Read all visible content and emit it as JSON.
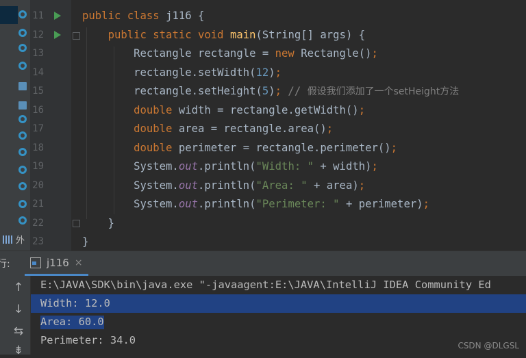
{
  "editor": {
    "lines": [
      {
        "num": "11",
        "tokens": [
          [
            "kw",
            "public "
          ],
          [
            "kw",
            "class "
          ],
          [
            "",
            "j116 {"
          ]
        ]
      },
      {
        "num": "12",
        "tokens": [
          [
            "",
            "    "
          ],
          [
            "kw",
            "public "
          ],
          [
            "kw",
            "static "
          ],
          [
            "kw",
            "void "
          ],
          [
            "fn",
            "main"
          ],
          [
            "",
            "(String[] args) {"
          ]
        ]
      },
      {
        "num": "13",
        "tokens": [
          [
            "",
            "        Rectangle rectangle = "
          ],
          [
            "kw",
            "new "
          ],
          [
            "",
            "Rectangle()"
          ],
          [
            "kw",
            ";"
          ]
        ]
      },
      {
        "num": "14",
        "tokens": [
          [
            "",
            "        rectangle.setWidth("
          ],
          [
            "nm",
            "12"
          ],
          [
            "",
            ")"
          ],
          [
            "kw",
            ";"
          ]
        ]
      },
      {
        "num": "15",
        "tokens": [
          [
            "",
            "        rectangle.setHeight("
          ],
          [
            "nm",
            "5"
          ],
          [
            "",
            ")"
          ],
          [
            "kw",
            ";"
          ],
          [
            "cm",
            " // "
          ],
          [
            "cmcn",
            "假设我们添加了一个setHeight方法"
          ]
        ]
      },
      {
        "num": "16",
        "tokens": [
          [
            "kw",
            "        double "
          ],
          [
            "",
            "width = rectangle.getWidth()"
          ],
          [
            "kw",
            ";"
          ]
        ]
      },
      {
        "num": "17",
        "tokens": [
          [
            "kw",
            "        double "
          ],
          [
            "",
            "area = rectangle.area()"
          ],
          [
            "kw",
            ";"
          ]
        ]
      },
      {
        "num": "18",
        "tokens": [
          [
            "kw",
            "        double "
          ],
          [
            "",
            "perimeter = rectangle.perimeter()"
          ],
          [
            "kw",
            ";"
          ]
        ]
      },
      {
        "num": "19",
        "tokens": [
          [
            "",
            "        System."
          ],
          [
            "fd",
            "out"
          ],
          [
            "",
            ".println("
          ],
          [
            "st",
            "\"Width: \""
          ],
          [
            "",
            " + width)"
          ],
          [
            "kw",
            ";"
          ]
        ]
      },
      {
        "num": "20",
        "tokens": [
          [
            "",
            "        System."
          ],
          [
            "fd",
            "out"
          ],
          [
            "",
            ".println("
          ],
          [
            "st",
            "\"Area: \""
          ],
          [
            "",
            " + area)"
          ],
          [
            "kw",
            ";"
          ]
        ]
      },
      {
        "num": "21",
        "tokens": [
          [
            "",
            "        System."
          ],
          [
            "fd",
            "out"
          ],
          [
            "",
            ".println("
          ],
          [
            "st",
            "\"Perimeter: \""
          ],
          [
            "",
            " + perimeter)"
          ],
          [
            "kw",
            ";"
          ]
        ]
      },
      {
        "num": "22",
        "tokens": [
          [
            "",
            "    }"
          ]
        ]
      },
      {
        "num": "23",
        "tokens": [
          [
            "",
            "}"
          ]
        ]
      }
    ]
  },
  "sidebar": {
    "external_label": "外"
  },
  "run_panel": {
    "label": "行:",
    "tab_name": "j116",
    "tab_close": "×",
    "tools": [
      "↑",
      "↓",
      "⇆",
      "⇟"
    ]
  },
  "console": {
    "lines": [
      "E:\\JAVA\\SDK\\bin\\java.exe \"-javaagent:E:\\JAVA\\IntelliJ IDEA Community Ed",
      "Width: 12.0",
      "Area: 60.0",
      "Perimeter: 34.0"
    ]
  },
  "watermark": "CSDN @DLGSL"
}
